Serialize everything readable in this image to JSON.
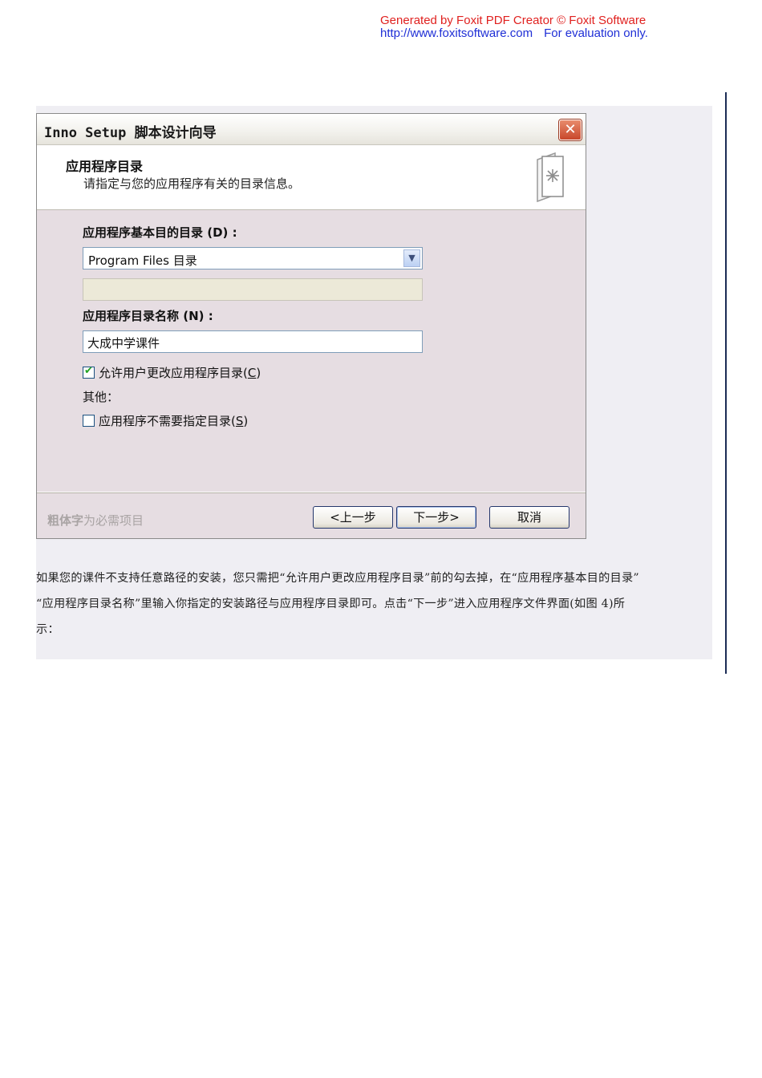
{
  "watermark": {
    "line1": "Generated by Foxit PDF Creator © Foxit Software",
    "line2_url": "http://www.foxitsoftware.com",
    "line2_note": "For evaluation only."
  },
  "dialog": {
    "title": "Inno Setup 脚本设计向导",
    "close_glyph": "✕",
    "header": {
      "title": "应用程序目录",
      "subtitle": "请指定与您的应用程序有关的目录信息。",
      "icon": "wizard-page-icon"
    },
    "base_dir_label": "应用程序基本目的目录 (D) :",
    "base_dir_value": "Program Files 目录",
    "custom_dir_value": "",
    "folder_name_label": "应用程序目录名称 (N) :",
    "folder_name_value": "大成中学课件",
    "allow_change": {
      "label": "允许用户更改应用程序目录",
      "accel": "C",
      "checked": true
    },
    "other_label": "其他：",
    "no_dir": {
      "label": "应用程序不需要指定目录",
      "accel": "S",
      "checked": false
    },
    "footer_note_bold": "粗体字",
    "footer_note_rest": "为必需项目",
    "buttons": {
      "back": "<上一步",
      "next": "下一步>",
      "cancel": "取消"
    }
  },
  "paragraph": {
    "line1": "如果您的课件不支持任意路径的安装，您只需把“允许用户更改应用程序目录”前的勾去掉，在“应用程序基本目的目录”",
    "line2": "“应用程序目录名称”里输入你指定的安装路径与应用程序目录即可。点击“下一步”进入应用程序文件界面(如图 4)所",
    "line3": "示："
  }
}
